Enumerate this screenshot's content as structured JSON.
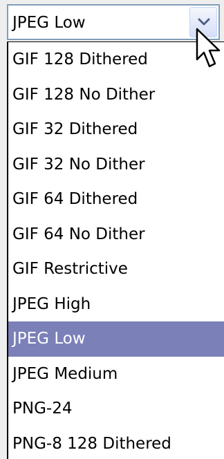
{
  "select": {
    "value": "JPEG Low",
    "arrow_icon": "chevron-down-icon",
    "border_color": "#7f9db9"
  },
  "options": [
    {
      "label": "GIF 128 Dithered",
      "selected": false
    },
    {
      "label": "GIF 128 No Dither",
      "selected": false
    },
    {
      "label": "GIF 32 Dithered",
      "selected": false
    },
    {
      "label": "GIF 32 No Dither",
      "selected": false
    },
    {
      "label": "GIF 64 Dithered",
      "selected": false
    },
    {
      "label": "GIF 64 No Dither",
      "selected": false
    },
    {
      "label": "GIF Restrictive",
      "selected": false
    },
    {
      "label": "JPEG High",
      "selected": false
    },
    {
      "label": "JPEG Low",
      "selected": true
    },
    {
      "label": "JPEG Medium",
      "selected": false
    },
    {
      "label": "PNG-24",
      "selected": false
    },
    {
      "label": "PNG-8 128 Dithered",
      "selected": false
    }
  ],
  "colors": {
    "highlight": "#7b80b8",
    "highlight_text": "#ffffff"
  },
  "cursor_icon": "arrow-pointer-icon"
}
